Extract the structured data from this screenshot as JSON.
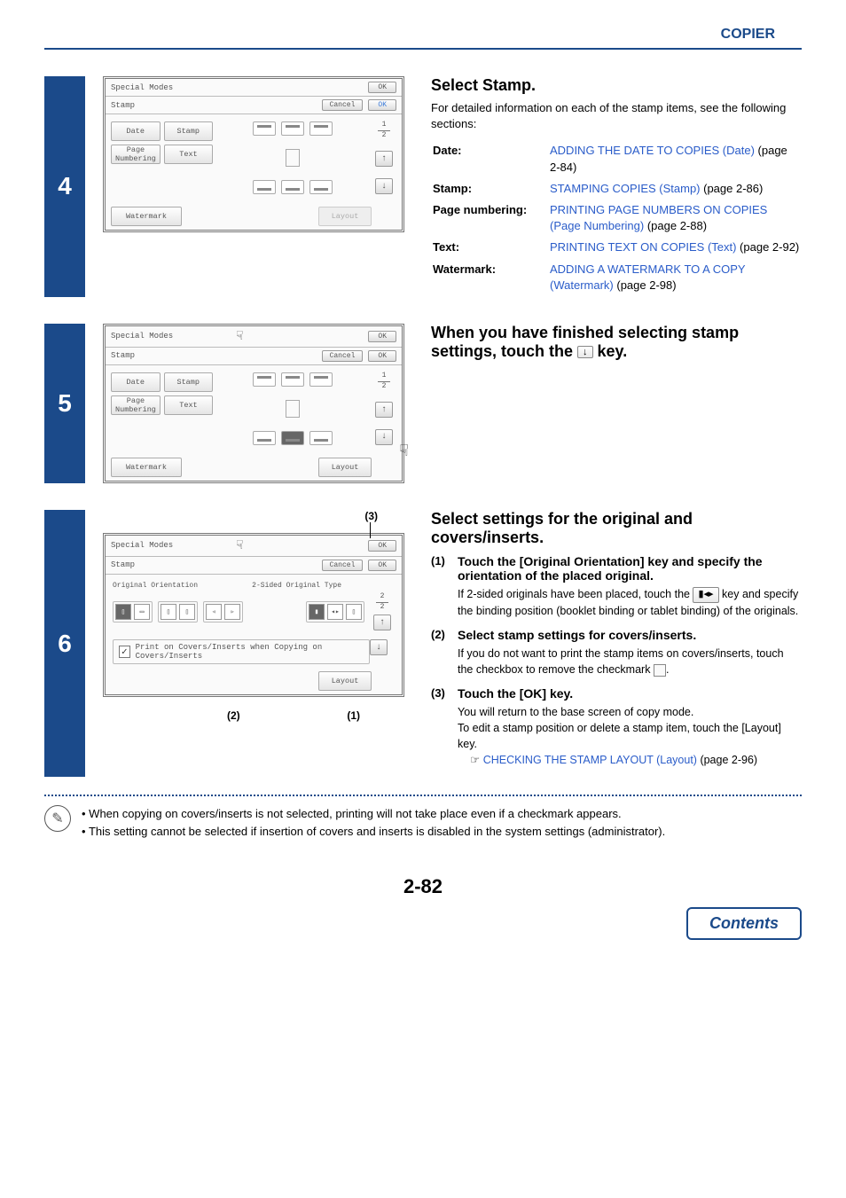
{
  "header": "COPIER",
  "steps": {
    "s4": {
      "num": "4",
      "title": "Select Stamp.",
      "desc": "For detailed information on each of the stamp items, see the following sections:",
      "defs": [
        {
          "label": "Date:",
          "link": "ADDING THE DATE TO COPIES (Date)",
          "after": " (page 2-84)"
        },
        {
          "label": "Stamp:",
          "link": "STAMPING COPIES (Stamp)",
          "after": " (page 2-86)"
        },
        {
          "label": "Page numbering:",
          "link": "PRINTING PAGE NUMBERS ON COPIES (Page Numbering)",
          "after": " (page 2-88)"
        },
        {
          "label": "Text:",
          "link": "PRINTING TEXT ON COPIES (Text)",
          "after": " (page 2-92)"
        },
        {
          "label": "Watermark:",
          "link": "ADDING A WATERMARK TO A COPY (Watermark)",
          "after": " (page 2-98)"
        }
      ],
      "panel": {
        "topTitle": "Special Modes",
        "ok": "OK",
        "rowTitle": "Stamp",
        "cancel": "Cancel",
        "btn_date": "Date",
        "btn_stamp": "Stamp",
        "btn_pagenum": "Page\nNumbering",
        "btn_text": "Text",
        "watermark": "Watermark",
        "layout": "Layout",
        "pg_cur": "1",
        "pg_tot": "2"
      }
    },
    "s5": {
      "num": "5",
      "title_a": "When you have finished selecting stamp settings, touch the ",
      "title_b": " key.",
      "panel": {
        "topTitle": "Special Modes",
        "ok": "OK",
        "rowTitle": "Stamp",
        "cancel": "Cancel",
        "btn_date": "Date",
        "btn_stamp": "Stamp",
        "btn_pagenum": "Page\nNumbering",
        "btn_text": "Text",
        "watermark": "Watermark",
        "layout": "Layout",
        "pg_cur": "1",
        "pg_tot": "2"
      }
    },
    "s6": {
      "num": "6",
      "title": "Select settings for the original and covers/inserts.",
      "call1": "(1)",
      "call2": "(2)",
      "call3": "(3)",
      "panel": {
        "topTitle": "Special Modes",
        "ok": "OK",
        "rowTitle": "Stamp",
        "cancel": "Cancel",
        "orient_label": "Original Orientation",
        "twosided_label": "2-Sided Original Type",
        "check_label": "Print on Covers/Inserts when Copying on Covers/Inserts",
        "layout": "Layout",
        "pg_cur": "2",
        "pg_tot": "2"
      },
      "subs": {
        "a": {
          "num": "(1)",
          "head": "Touch the [Original Orientation] key and specify the orientation of the placed original.",
          "text_a": "If 2-sided originals have been placed, touch the ",
          "text_b": " key and specify the binding position (booklet binding or tablet binding) of the originals."
        },
        "b": {
          "num": "(2)",
          "head": "Select stamp settings for covers/inserts.",
          "text_a": "If you do not want to print the stamp items on covers/inserts, touch the checkbox to remove the checkmark ",
          "text_b": "."
        },
        "c": {
          "num": "(3)",
          "head": "Touch the [OK] key.",
          "text1": "You will return to the base screen of copy mode.",
          "text2": "To edit a stamp position or delete a stamp item, touch the [Layout] key.",
          "link": "CHECKING THE STAMP LAYOUT (Layout)",
          "after": " (page 2-96)"
        }
      }
    }
  },
  "notes": {
    "n1": "When copying on covers/inserts is not selected, printing will not take place even if a checkmark appears.",
    "n2": "This setting cannot be selected if insertion of covers and inserts is disabled in the system settings (administrator)."
  },
  "pageNum": "2-82",
  "contentsBtn": "Contents",
  "icons": {
    "down": "↓",
    "up": "↑",
    "check": "✓",
    "hand": "☟",
    "book": "▮◂▸",
    "handpoint": "☟"
  }
}
